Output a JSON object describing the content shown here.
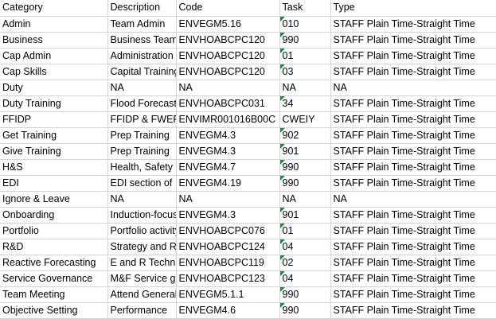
{
  "header": {
    "category": "Category",
    "description": "Description",
    "code": "Code",
    "task": "Task",
    "type": "Type"
  },
  "rows": [
    {
      "category": "Admin",
      "description": "Team Admin",
      "code": "ENVEGM5.16",
      "task": "010",
      "type": "STAFF Plain Time-Straight Time",
      "task_flag": true
    },
    {
      "category": "Business",
      "description": "Business Team",
      "code": "ENVHOABCPC120",
      "task": "990",
      "type": "STAFF Plain Time-Straight Time",
      "task_flag": true
    },
    {
      "category": "Cap Admin",
      "description": "Administration",
      "code": "ENVHOABCPC120",
      "task": "01",
      "type": "STAFF Plain Time-Straight Time",
      "task_flag": true
    },
    {
      "category": "Cap Skills",
      "description": "Capital Training",
      "code": "ENVHOABCPC120",
      "task": "03",
      "type": "STAFF Plain Time-Straight Time",
      "task_flag": true
    },
    {
      "category": "Duty",
      "description": "NA",
      "code": "NA",
      "task": "NA",
      "type": "NA",
      "task_flag": false
    },
    {
      "category": "Duty Training",
      "description": "Flood Forecasting",
      "code": "ENVHOABCPC031",
      "task": "34",
      "type": "STAFF Plain Time-Straight Time",
      "task_flag": true
    },
    {
      "category": "FFIDP",
      "description": "FFIDP & FWEP",
      "code": "ENVIMR001016B00C",
      "task": "CWEIY",
      "type": "STAFF Plain Time-Straight Time",
      "task_flag": false
    },
    {
      "category": "Get Training",
      "description": "Prep Training",
      "code": "ENVEGM4.3",
      "task": "902",
      "type": "STAFF Plain Time-Straight Time",
      "task_flag": true
    },
    {
      "category": "Give Training",
      "description": "Prep Training",
      "code": "ENVEGM4.3",
      "task": "901",
      "type": "STAFF Plain Time-Straight Time",
      "task_flag": true
    },
    {
      "category": "H&S",
      "description": "Health, Safety",
      "code": "ENVEGM4.7",
      "task": "990",
      "type": "STAFF Plain Time-Straight Time",
      "task_flag": true
    },
    {
      "category": "EDI",
      "description": "EDI section of",
      "code": "ENVEGM4.19",
      "task": "990",
      "type": "STAFF Plain Time-Straight Time",
      "task_flag": true
    },
    {
      "category": "Ignore & Leave",
      "description": "NA",
      "code": "NA",
      "task": "NA",
      "type": "NA",
      "task_flag": false
    },
    {
      "category": "Onboarding",
      "description": "Induction-focus",
      "code": "ENVEGM4.3",
      "task": "901",
      "type": "STAFF Plain Time-Straight Time",
      "task_flag": true
    },
    {
      "category": "Portfolio",
      "description": "Portfolio activity",
      "code": "ENVHOABCPC076",
      "task": "01",
      "type": "STAFF Plain Time-Straight Time",
      "task_flag": true
    },
    {
      "category": "R&D",
      "description": "Strategy and R",
      "code": "ENVHOABCPC124",
      "task": "04",
      "type": "STAFF Plain Time-Straight Time",
      "task_flag": true
    },
    {
      "category": "Reactive Forecasting",
      "description": "E and R Technical",
      "code": "ENVHOABCPC119",
      "task": "02",
      "type": "STAFF Plain Time-Straight Time",
      "task_flag": true
    },
    {
      "category": "Service Governance",
      "description": "M&F Service gov",
      "code": "ENVHOABCPC123",
      "task": "04",
      "type": "STAFF Plain Time-Straight Time",
      "task_flag": true
    },
    {
      "category": "Team Meeting",
      "description": "Attend General",
      "code": "ENVEGM5.1.1",
      "task": "990",
      "type": "STAFF Plain Time-Straight Time",
      "task_flag": true
    },
    {
      "category": "Objective Setting",
      "description": "Performance",
      "code": "ENVEGM4.6",
      "task": "990",
      "type": "STAFF Plain Time-Straight Time",
      "task_flag": true
    }
  ],
  "colors": {
    "gridline": "#d4d4d4",
    "flag_triangle": "#1e8b3c"
  }
}
